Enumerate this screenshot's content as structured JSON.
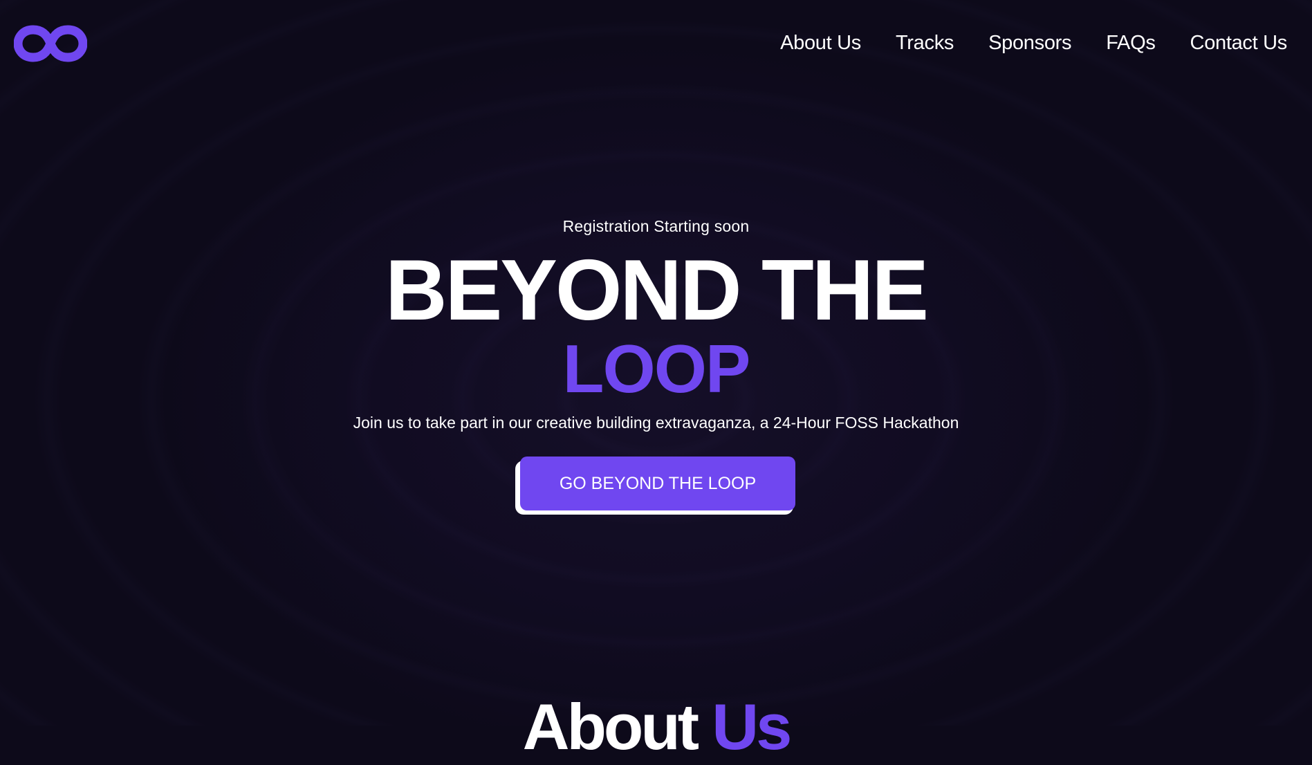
{
  "brand": {
    "logo_icon": "infinity-icon",
    "accent_color": "#7047f0",
    "background_color": "#0d0a1a"
  },
  "nav": {
    "items": [
      {
        "label": "About Us"
      },
      {
        "label": "Tracks"
      },
      {
        "label": "Sponsors"
      },
      {
        "label": "FAQs"
      },
      {
        "label": "Contact Us"
      }
    ]
  },
  "hero": {
    "kicker": "Registration Starting soon",
    "title_line1": "BEYOND THE",
    "title_line2": "LOOP",
    "subtitle": "Join us to take part in our creative building extravaganza, a 24-Hour FOSS Hackathon",
    "cta_label": "GO BEYOND THE LOOP"
  },
  "about": {
    "title_part1": "About",
    "title_part2": "Us"
  }
}
